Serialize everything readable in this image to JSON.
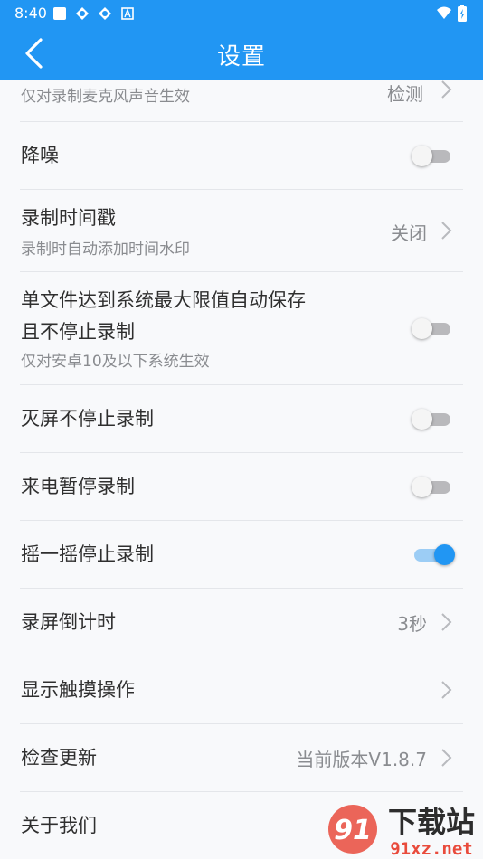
{
  "status_bar": {
    "time": "8:40",
    "icons": [
      "square-icon",
      "pinwheel-icon",
      "pinwheel-icon",
      "a-badge-icon",
      "wifi-icon",
      "battery-icon"
    ]
  },
  "header": {
    "title": "设置",
    "back_icon": "chevron-left-icon"
  },
  "rows": [
    {
      "title": "",
      "subtitle": "仅对录制麦克风声音生效",
      "value": "检测"
    },
    {
      "title": "降噪",
      "toggle": "off"
    },
    {
      "title": "录制时间戳",
      "subtitle": "录制时自动添加时间水印",
      "value": "关闭"
    },
    {
      "title_line1": "单文件达到系统最大限值自动保存",
      "title_line2": "且不停止录制",
      "subtitle": "仅对安卓10及以下系统生效",
      "toggle": "off"
    },
    {
      "title": "灭屏不停止录制",
      "toggle": "off"
    },
    {
      "title": "来电暂停录制",
      "toggle": "off"
    },
    {
      "title": "摇一摇停止录制",
      "toggle": "on"
    },
    {
      "title": "录屏倒计时",
      "value": "3秒"
    },
    {
      "title": "显示触摸操作",
      "value": ""
    },
    {
      "title": "检查更新",
      "value": "当前版本V1.8.7"
    },
    {
      "title": "关于我们"
    }
  ],
  "watermark": {
    "text": "下载站",
    "domain": "91xz.net"
  },
  "colors": {
    "primary": "#2196f3",
    "track_off": "#b9b9bc",
    "track_on": "#9ccdf5",
    "divider": "#e4e6ea"
  }
}
